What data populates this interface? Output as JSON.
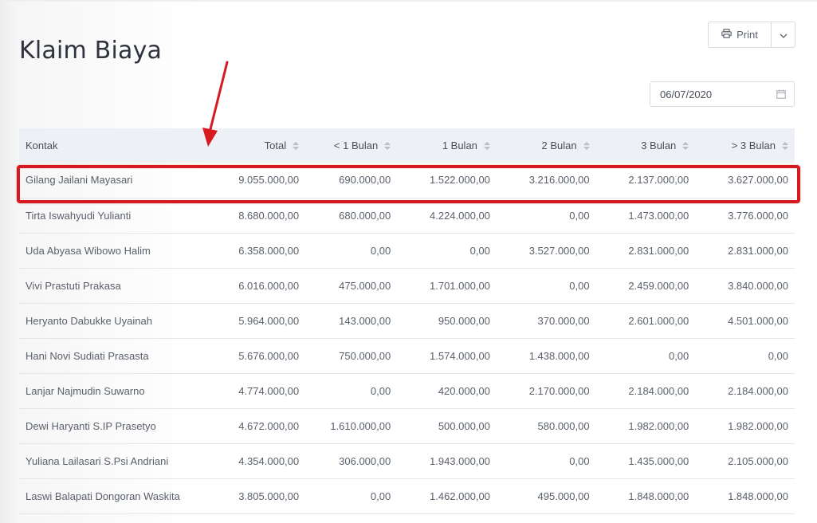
{
  "page": {
    "title": "Klaim Biaya",
    "print_label": "Print",
    "date_value": "06/07/2020"
  },
  "icons": {
    "print": "printer-icon",
    "caret": "chevron-down-icon",
    "calendar": "calendar-icon",
    "sort": "sort-icon"
  },
  "colors": {
    "highlight": "#d71920",
    "header_bg": "#edf0f5"
  },
  "table": {
    "headers": [
      "Kontak",
      "Total",
      "< 1 Bulan",
      "1 Bulan",
      "2 Bulan",
      "3 Bulan",
      "> 3 Bulan"
    ],
    "rows": [
      [
        "Gilang Jailani Mayasari",
        "9.055.000,00",
        "690.000,00",
        "1.522.000,00",
        "3.216.000,00",
        "2.137.000,00",
        "3.627.000,00"
      ],
      [
        "Tirta Iswahyudi Yulianti",
        "8.680.000,00",
        "680.000,00",
        "4.224.000,00",
        "0,00",
        "1.473.000,00",
        "3.776.000,00"
      ],
      [
        "Uda Abyasa Wibowo Halim",
        "6.358.000,00",
        "0,00",
        "0,00",
        "3.527.000,00",
        "2.831.000,00",
        "2.831.000,00"
      ],
      [
        "Vivi Prastuti Prakasa",
        "6.016.000,00",
        "475.000,00",
        "1.701.000,00",
        "0,00",
        "2.459.000,00",
        "3.840.000,00"
      ],
      [
        "Heryanto Dabukke Uyainah",
        "5.964.000,00",
        "143.000,00",
        "950.000,00",
        "370.000,00",
        "2.601.000,00",
        "4.501.000,00"
      ],
      [
        "Hani Novi Sudiati Prasasta",
        "5.676.000,00",
        "750.000,00",
        "1.574.000,00",
        "1.438.000,00",
        "0,00",
        "0,00"
      ],
      [
        "Lanjar Najmudin Suwarno",
        "4.774.000,00",
        "0,00",
        "420.000,00",
        "2.170.000,00",
        "2.184.000,00",
        "2.184.000,00"
      ],
      [
        "Dewi Haryanti S.IP Prasetyo",
        "4.672.000,00",
        "1.610.000,00",
        "500.000,00",
        "580.000,00",
        "1.982.000,00",
        "1.982.000,00"
      ],
      [
        "Yuliana Lailasari S.Psi Andriani",
        "4.354.000,00",
        "306.000,00",
        "1.943.000,00",
        "0,00",
        "1.435.000,00",
        "2.105.000,00"
      ],
      [
        "Laswi Balapati Dongoran Waskita",
        "3.805.000,00",
        "0,00",
        "1.462.000,00",
        "495.000,00",
        "1.848.000,00",
        "1.848.000,00"
      ]
    ]
  }
}
